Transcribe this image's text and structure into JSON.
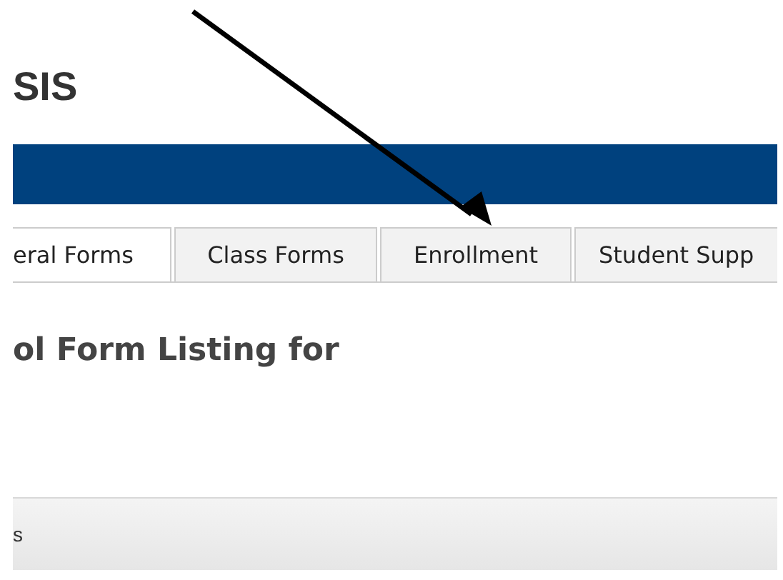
{
  "header": {
    "title": "SIS"
  },
  "tabs": [
    {
      "label": "eral Forms",
      "selected": true
    },
    {
      "label": "Class Forms",
      "selected": false
    },
    {
      "label": "Enrollment",
      "selected": false
    },
    {
      "label": "Student Supp",
      "selected": false
    }
  ],
  "heading": "ol Form Listing for",
  "footer_bar": {
    "text": "s"
  }
}
